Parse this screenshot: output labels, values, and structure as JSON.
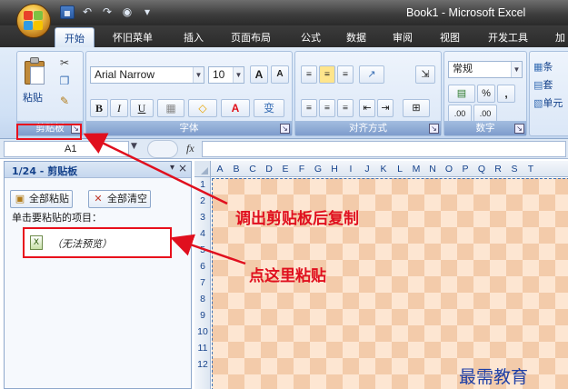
{
  "window": {
    "title": "Book1 - Microsoft Excel"
  },
  "qat": {
    "undo_glyph": "↶",
    "redo_glyph": "↷",
    "save_glyph": "▪",
    "extra_glyph": "◉",
    "customize_glyph": "▾"
  },
  "tabs": [
    {
      "label": "开始",
      "active": true
    },
    {
      "label": "怀旧菜单"
    },
    {
      "label": "插入"
    },
    {
      "label": "页面布局"
    },
    {
      "label": "公式"
    },
    {
      "label": "数据"
    },
    {
      "label": "审阅"
    },
    {
      "label": "视图"
    },
    {
      "label": "开发工具"
    },
    {
      "label": "加"
    }
  ],
  "ribbon": {
    "clipboard": {
      "label": "剪贴板",
      "paste_label": "粘贴",
      "launcher_glyph": "↘"
    },
    "font": {
      "label": "字体",
      "font_name": "Arial Narrow",
      "font_size": "10",
      "grow_glyph": "A",
      "shrink_glyph": "A",
      "bold": "B",
      "italic": "I",
      "underline": "U",
      "fill_glyph": "◇",
      "color_glyph": "A",
      "wen_glyph": "变"
    },
    "alignment": {
      "label": "对齐方式"
    },
    "number": {
      "label": "数字",
      "format": "常规",
      "percent": "%",
      "comma": ",",
      "inc_decimal": ".00",
      "dec_decimal": ".00"
    },
    "styles": {
      "items": [
        "条",
        "套",
        "单元"
      ]
    }
  },
  "formula_bar": {
    "name_box": "A1",
    "fx": "fx"
  },
  "clipboard_pane": {
    "title": "1/24 - 剪贴板",
    "menu_glyph": "▾",
    "close_glyph": "×",
    "paste_all": "全部粘贴",
    "clear_all": "全部清空",
    "hint": "单击要粘贴的项目：",
    "item_text": "（无法预览）"
  },
  "sheet": {
    "columns": [
      "A",
      "B",
      "C",
      "D",
      "E",
      "F",
      "G",
      "H",
      "I",
      "J",
      "K",
      "L",
      "M",
      "N",
      "O",
      "P",
      "Q",
      "R",
      "S",
      "T"
    ],
    "rows": [
      "1",
      "2",
      "3",
      "4",
      "5",
      "6",
      "7",
      "8",
      "9",
      "10",
      "11",
      "12"
    ]
  },
  "annotations": {
    "copy_note": "调出剪贴板后复制",
    "paste_note": "点这里粘贴",
    "watermark": "最需教育"
  },
  "colors": {
    "annotation_red": "#e00f1e",
    "checker_light": "#fde6d2",
    "checker_dark": "#f3cbaa",
    "ribbon_blue": "#15428b"
  }
}
